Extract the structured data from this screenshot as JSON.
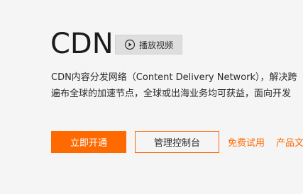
{
  "hero": {
    "title": "CDN",
    "video_button_label": "播放视频",
    "description_lines": [
      "CDN内容分发网络（Content Delivery Network），解决跨",
      "遍布全球的加速节点，全球或出海业务均可获益，面向开发"
    ],
    "actions": {
      "primary": "立即开通",
      "secondary": "管理控制台",
      "link_trial": "免费试用",
      "link_doc": "产品文"
    },
    "colors": {
      "accent": "#ff6a00",
      "background": "#f5f5f6",
      "video_button_bg": "#dedede"
    },
    "icons": {
      "video": "play-circle-icon"
    }
  }
}
